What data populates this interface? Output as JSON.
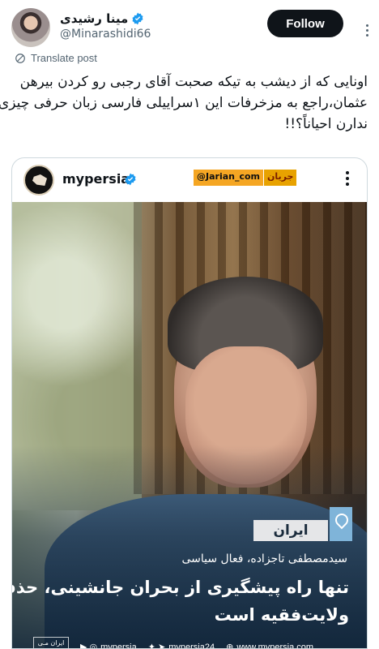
{
  "header": {
    "display_name": "مینا رشیدی",
    "handle": "@Minarashidi66",
    "follow_label": "Follow"
  },
  "translate_label": "Translate post",
  "tweet_lines": [
    "اونایی که از دیشب به تیکه صحبت آقای رجبی رو کردن بیرهن",
    "عثمان،راجع به مزخرفات این ۱سراییلی فارسی زبان حرفی چیزی",
    "ندارن احیاناً؟!!"
  ],
  "card": {
    "account_name": "mypersia",
    "watermark": "@Jarian_com",
    "watermark_logo": "جریان",
    "location": "ایران",
    "subtitle": "سیدمصطفی تاجزاده، فعال سیاسی",
    "headline_lines": [
      "تنها راه پیشگیری از بحران جانشینی، حذف",
      "ولایت‌فقیه است"
    ],
    "logo_text": "ایران مـی",
    "footer": {
      "left": "mypersia",
      "middle": "mypersia24",
      "right": "www.mypersia.com"
    }
  },
  "colors": {
    "verified": "#1d9bf0",
    "follow_bg": "#0f1419",
    "secondary_text": "#536471"
  }
}
